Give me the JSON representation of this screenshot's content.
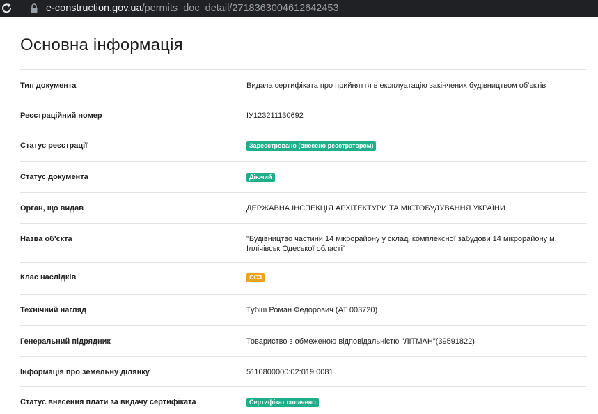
{
  "browser": {
    "url_host": "e-construction.gov.ua",
    "url_path": "/permits_doc_detail/2718363004612642453"
  },
  "page": {
    "title": "Основна інформація"
  },
  "rows": [
    {
      "label": "Тип документа",
      "value": "Видача сертифіката про прийняття в експлуатацію закінчених будівництвом об'єктів"
    },
    {
      "label": "Реєстраційний номер",
      "value": "ІУ123211130692"
    },
    {
      "label": "Статус реєстрації",
      "badge": "Зареєстровано (внесено реєстратором)",
      "badge_color": "#1fae8a"
    },
    {
      "label": "Статус документа",
      "badge": "Діючий",
      "badge_color": "#1fae8a"
    },
    {
      "label": "Орган, що видав",
      "value": "ДЕРЖАВНА ІНСПЕКЦІЯ АРХІТЕКТУРИ ТА МІСТОБУДУВАННЯ УКРАЇНИ"
    },
    {
      "label": "Назва об'єкта",
      "value": "\"Будівництво частини 14 мікрорайону у складі комплексної забудови 14 мікрорайону м. Іллічівськ Одеської області\""
    },
    {
      "label": "Клас наслідків",
      "badge": "СС3",
      "badge_color": "#f0a21a"
    },
    {
      "label": "Технічний нагляд",
      "value": "Тубіш Роман Федорович (АТ 003720)"
    },
    {
      "label": "Генеральний підрядник",
      "value": "Товариство з обмеженою відповідальністю \"ЛІТМАН\"(39591822)"
    },
    {
      "label": "Інформація про земельну ділянку",
      "value": "5110800000:02:019:0081"
    },
    {
      "label": "Статус внесення плати за видачу сертифіката",
      "badge": "Сертифікат сплачено",
      "badge_color": "#1fae8a"
    }
  ]
}
